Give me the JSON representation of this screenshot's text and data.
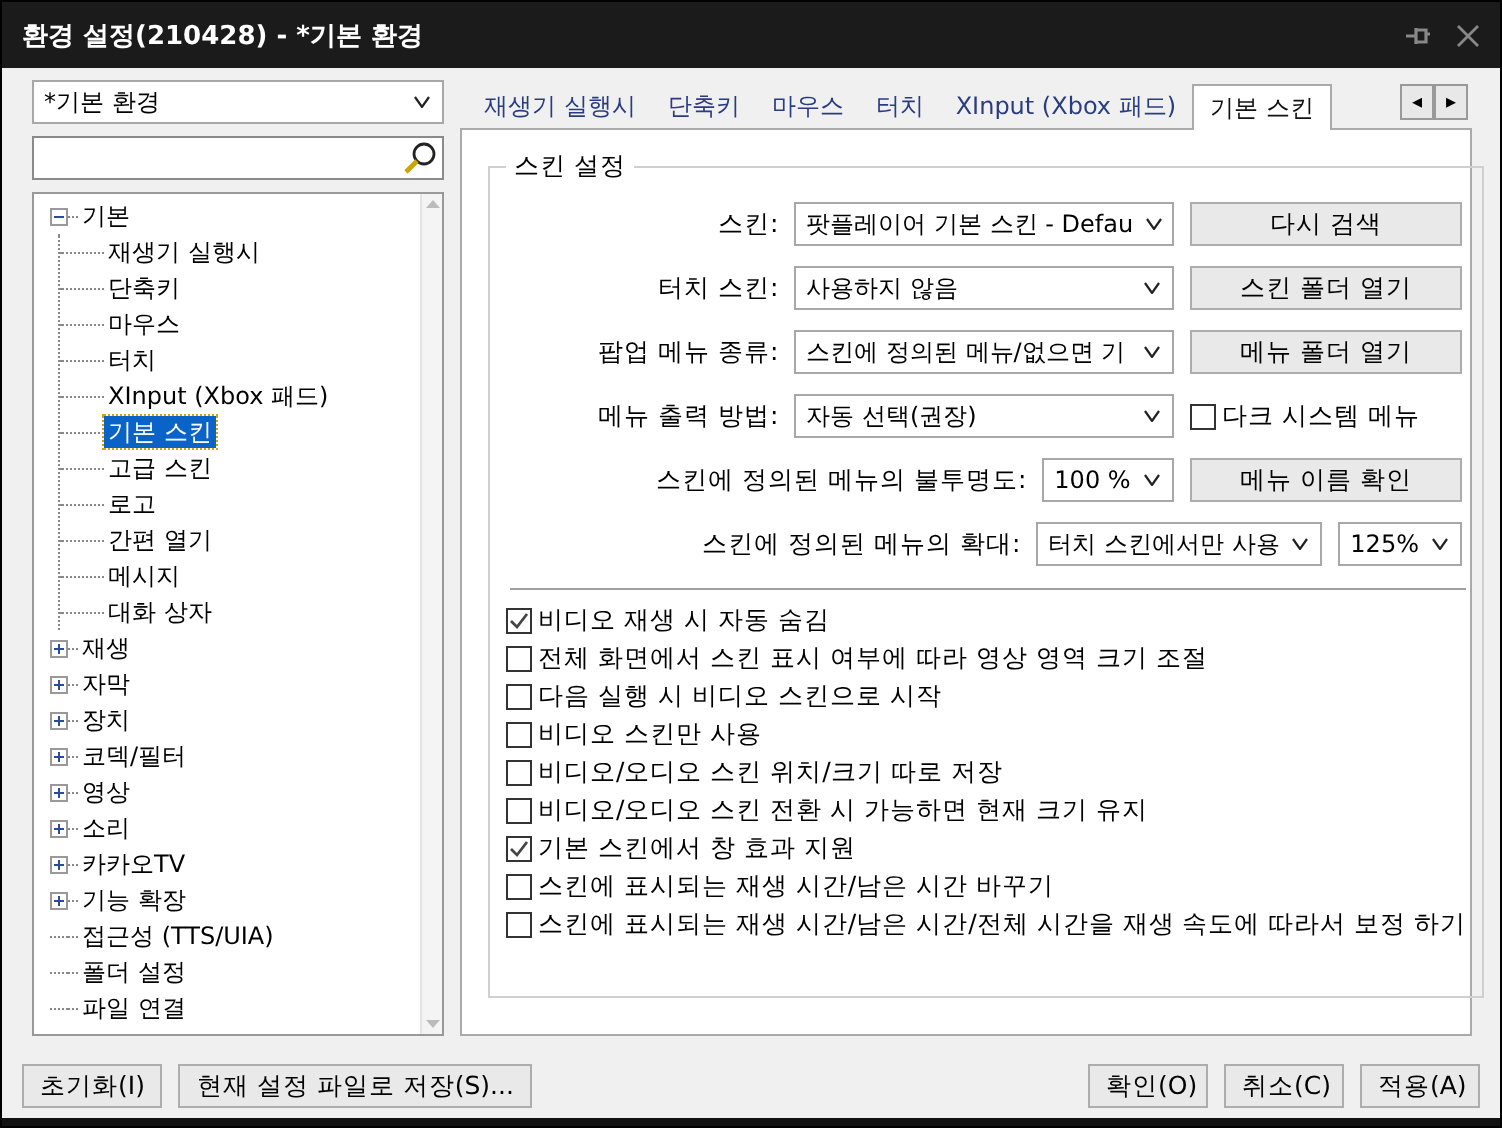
{
  "window": {
    "title": "환경 설정(210428) - *기본 환경"
  },
  "preset": {
    "value": "*기본 환경"
  },
  "tree": [
    {
      "label": "기본",
      "expanded": true,
      "selected": false,
      "children": [
        {
          "label": "재생기 실행시",
          "selected": false
        },
        {
          "label": "단축키",
          "selected": false
        },
        {
          "label": "마우스",
          "selected": false
        },
        {
          "label": "터치",
          "selected": false
        },
        {
          "label": "XInput (Xbox 패드)",
          "selected": false
        },
        {
          "label": "기본 스킨",
          "selected": true
        },
        {
          "label": "고급 스킨",
          "selected": false
        },
        {
          "label": "로고",
          "selected": false
        },
        {
          "label": "간편 열기",
          "selected": false
        },
        {
          "label": "메시지",
          "selected": false
        },
        {
          "label": "대화 상자",
          "selected": false
        }
      ]
    },
    {
      "label": "재생",
      "expanded": false,
      "selected": false
    },
    {
      "label": "자막",
      "expanded": false,
      "selected": false
    },
    {
      "label": "장치",
      "expanded": false,
      "selected": false
    },
    {
      "label": "코덱/필터",
      "expanded": false,
      "selected": false
    },
    {
      "label": "영상",
      "expanded": false,
      "selected": false
    },
    {
      "label": "소리",
      "expanded": false,
      "selected": false
    },
    {
      "label": "카카오TV",
      "expanded": false,
      "selected": false
    },
    {
      "label": "기능 확장",
      "expanded": false,
      "selected": false
    },
    {
      "label": "접근성 (TTS/UIA)",
      "selected": false
    },
    {
      "label": "폴더 설정",
      "selected": false
    },
    {
      "label": "파일 연결",
      "selected": false
    }
  ],
  "tabs": [
    {
      "label": "재생기 실행시",
      "selected": false
    },
    {
      "label": "단축키",
      "selected": false
    },
    {
      "label": "마우스",
      "selected": false
    },
    {
      "label": "터치",
      "selected": false
    },
    {
      "label": "XInput (Xbox 패드)",
      "selected": false
    },
    {
      "label": "기본 스킨",
      "selected": true
    }
  ],
  "tab_scroll": [
    "◂",
    "▸"
  ],
  "skin_settings": {
    "title": "스킨 설정",
    "rows": [
      {
        "label": "스킨:",
        "controls": [
          {
            "kind": "combo",
            "value": "팟플레이어 기본 스킨 - Defau"
          },
          {
            "kind": "button",
            "label": "다시 검색"
          }
        ]
      },
      {
        "label": "터치 스킨:",
        "controls": [
          {
            "kind": "combo",
            "value": "사용하지 않음"
          },
          {
            "kind": "button",
            "label": "스킨 폴더 열기"
          }
        ]
      },
      {
        "label": "팝업 메뉴 종류:",
        "controls": [
          {
            "kind": "combo",
            "value": "스킨에 정의된 메뉴/없으면 기"
          },
          {
            "kind": "button",
            "label": "메뉴 폴더 열기"
          }
        ]
      },
      {
        "label": "메뉴 출력 방법:",
        "controls": [
          {
            "kind": "combo",
            "value": "자동 선택(권장)"
          },
          {
            "kind": "checkbox",
            "label": "다크 시스템 메뉴",
            "checked": false
          }
        ]
      },
      {
        "label": "스킨에 정의된 메뉴의 불투명도:",
        "controls": [
          {
            "kind": "combo",
            "value": "100 %"
          },
          {
            "kind": "button",
            "label": "메뉴 이름 확인"
          }
        ]
      },
      {
        "label": "스킨에 정의된 메뉴의 확대:",
        "controls": [
          {
            "kind": "combo",
            "value": "터치 스킨에서만 사용"
          },
          {
            "kind": "combo",
            "value": "125%"
          }
        ]
      }
    ],
    "options": [
      {
        "label": "비디오 재생 시 자동 숨김",
        "checked": true
      },
      {
        "label": "전체 화면에서 스킨 표시 여부에 따라 영상 영역 크기 조절",
        "checked": false
      },
      {
        "label": "다음 실행 시 비디오 스킨으로 시작",
        "checked": false
      },
      {
        "label": "비디오 스킨만 사용",
        "checked": false
      },
      {
        "label": "비디오/오디오 스킨 위치/크기 따로 저장",
        "checked": false
      },
      {
        "label": "비디오/오디오 스킨 전환 시 가능하면 현재 크기 유지",
        "checked": false
      },
      {
        "label": "기본 스킨에서 창 효과 지원",
        "checked": true
      },
      {
        "label": "스킨에 표시되는 재생 시간/남은 시간 바꾸기",
        "checked": false
      },
      {
        "label": "스킨에 표시되는 재생 시간/남은 시간/전체 시간을 재생 속도에 따라서 보정 하기",
        "checked": false
      }
    ]
  },
  "footer": {
    "left": [
      "초기화(I)",
      "현재 설정 파일로 저장(S)..."
    ],
    "right": [
      "확인(O)",
      "취소(C)",
      "적용(A)"
    ]
  }
}
